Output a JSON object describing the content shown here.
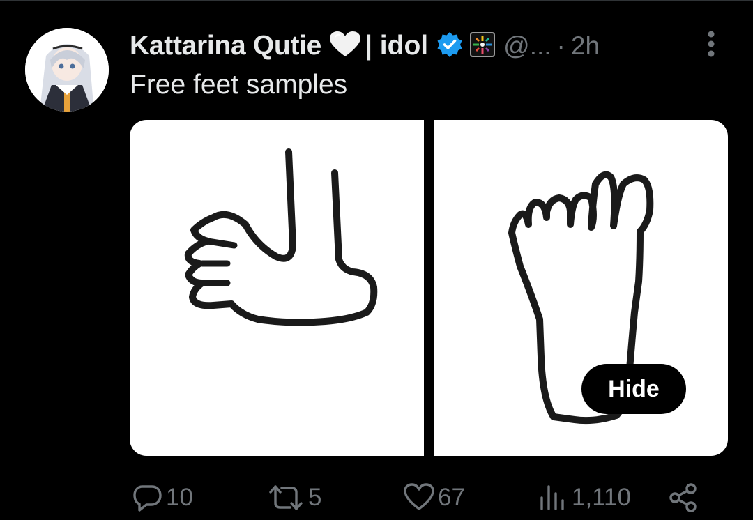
{
  "tweet": {
    "author_name": "Kattarina Qutie",
    "affiliation": "| idol",
    "handle": "@...",
    "separator": "·",
    "time": "2h",
    "text": "Free feet samples",
    "hide_label": "Hide"
  },
  "icons": {
    "heart": "white-heart-emoji",
    "verified": "verified-badge",
    "affiliate": "affiliate-badge",
    "more": "vertical-ellipsis",
    "reply": "speech-bubble",
    "retweet": "retweet-arrows",
    "like": "heart-outline",
    "views": "bar-chart",
    "share": "share-nodes"
  },
  "actions": {
    "replies": "10",
    "retweets": "5",
    "likes": "67",
    "views": "1,110"
  },
  "colors": {
    "background": "#000000",
    "text": "#e7e9ea",
    "muted": "#71767b",
    "verified": "#1d9bf0"
  }
}
